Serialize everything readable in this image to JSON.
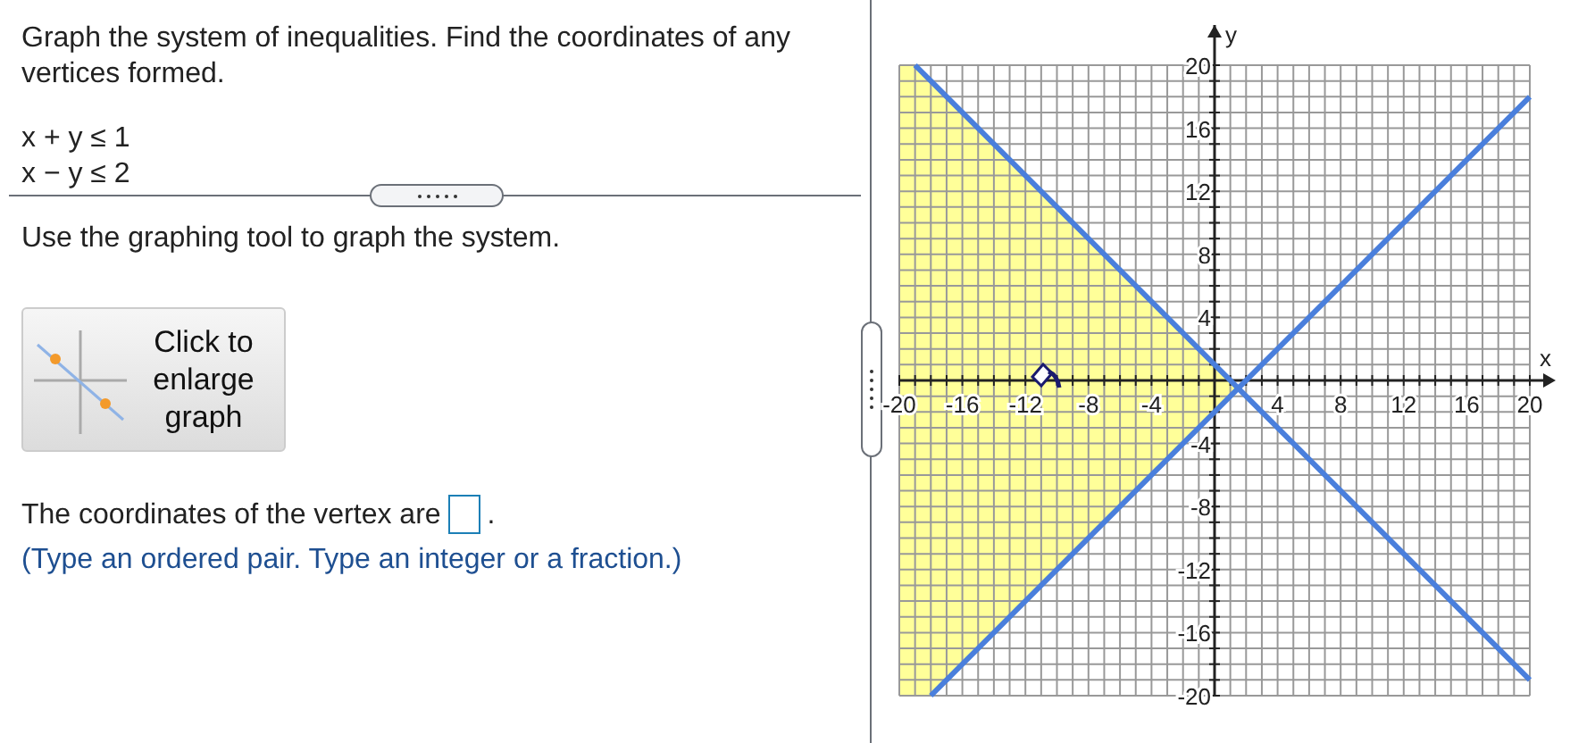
{
  "question": {
    "prompt": "Graph the system of inequalities. Find the coordinates of any vertices formed.",
    "inequalities": [
      "x + y ≤ 1",
      "x − y ≤ 2"
    ]
  },
  "instruction": "Use the graphing tool to graph the system.",
  "enlarge_button": {
    "label": "Click to enlarge graph"
  },
  "answer": {
    "prefix": "The coordinates of the vertex are",
    "suffix": ".",
    "hint": "(Type an ordered pair. Type an integer or a fraction.)"
  },
  "graph": {
    "chart_data": {
      "type": "line",
      "xlabel": "x",
      "ylabel": "y",
      "xlim": [
        -20,
        20
      ],
      "ylim": [
        -20,
        20
      ],
      "grid": true,
      "xticks": [
        -20,
        -16,
        -12,
        -8,
        -4,
        4,
        8,
        12,
        16,
        20
      ],
      "yticks": [
        -20,
        -16,
        -12,
        -8,
        -4,
        4,
        8,
        12,
        16,
        20
      ],
      "x": [
        -19,
        -18,
        20
      ],
      "series": [
        {
          "color": "#4a7fdc",
          "values": [
            20,
            19,
            -19
          ]
        },
        {
          "color": "#4a7fdc",
          "values": [
            null,
            -20,
            18
          ]
        }
      ]
    }
  }
}
